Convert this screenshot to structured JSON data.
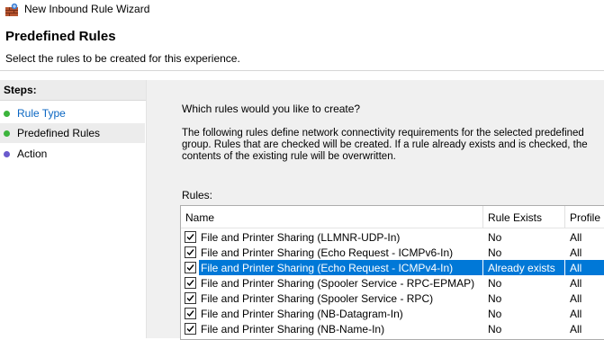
{
  "window": {
    "title": "New Inbound Rule Wizard",
    "icon": "firewall-icon"
  },
  "header": {
    "title": "Predefined Rules",
    "subtitle": "Select the rules to be created for this experience."
  },
  "sidebar": {
    "header": "Steps:",
    "steps": [
      {
        "label": "Rule Type",
        "status_color": "#3cb43c",
        "link": true
      },
      {
        "label": "Predefined Rules",
        "status_color": "#3cb43c",
        "active": true
      },
      {
        "label": "Action",
        "status_color": "#6a5acd"
      }
    ]
  },
  "main": {
    "question": "Which rules would you like to create?",
    "description": "The following rules define network connectivity requirements for the selected predefined group. Rules that are checked will be created. If a rule already exists and is checked, the contents of the existing rule will be overwritten.",
    "rules_label": "Rules:",
    "columns": [
      "Name",
      "Rule Exists",
      "Profile"
    ],
    "rows": [
      {
        "name": "File and Printer Sharing (LLMNR-UDP-In)",
        "exists": "No",
        "profile": "All",
        "checked": true
      },
      {
        "name": "File and Printer Sharing (Echo Request - ICMPv6-In)",
        "exists": "No",
        "profile": "All",
        "checked": true
      },
      {
        "name": "File and Printer Sharing (Echo Request - ICMPv4-In)",
        "exists": "Already exists",
        "profile": "All",
        "checked": true,
        "selected": true
      },
      {
        "name": "File and Printer Sharing (Spooler Service - RPC-EPMAP)",
        "exists": "No",
        "profile": "All",
        "checked": true
      },
      {
        "name": "File and Printer Sharing (Spooler Service - RPC)",
        "exists": "No",
        "profile": "All",
        "checked": true
      },
      {
        "name": "File and Printer Sharing (NB-Datagram-In)",
        "exists": "No",
        "profile": "All",
        "checked": true
      },
      {
        "name": "File and Printer Sharing (NB-Name-In)",
        "exists": "No",
        "profile": "All",
        "checked": true
      }
    ]
  },
  "colors": {
    "selection": "#0078d7",
    "link": "#0a66c2"
  }
}
